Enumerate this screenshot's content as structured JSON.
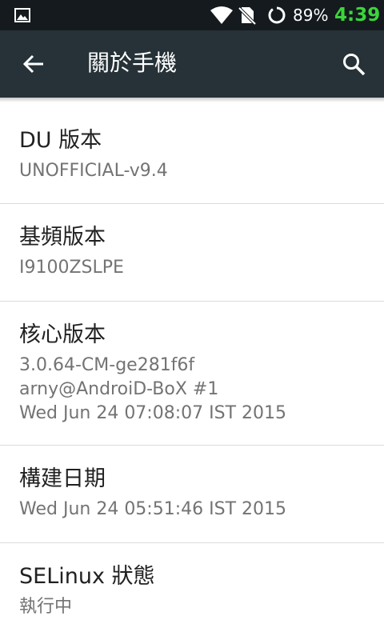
{
  "status_bar": {
    "battery_percent": "89%",
    "time": "4:39",
    "time_color": "#3cd53c",
    "icons": [
      "gallery-icon",
      "wifi-icon",
      "no-sim-icon",
      "battery-circle-icon"
    ]
  },
  "app_bar": {
    "title": "關於手機",
    "back_icon": "arrow-back-icon",
    "search_icon": "search-icon",
    "background": "#263238"
  },
  "items": [
    {
      "title": "DU 版本",
      "summary": [
        "UNOFFICIAL-v9.4"
      ]
    },
    {
      "title": "基頻版本",
      "summary": [
        "I9100ZSLPE"
      ]
    },
    {
      "title": "核心版本",
      "summary": [
        "3.0.64-CM-ge281f6f",
        "arny@AndroiD-BoX #1",
        "Wed Jun 24 07:08:07 IST 2015"
      ]
    },
    {
      "title": "構建日期",
      "summary": [
        "Wed Jun 24 05:51:46 IST 2015"
      ]
    },
    {
      "title": "SELinux 狀態",
      "summary": [
        "執行中"
      ]
    }
  ]
}
